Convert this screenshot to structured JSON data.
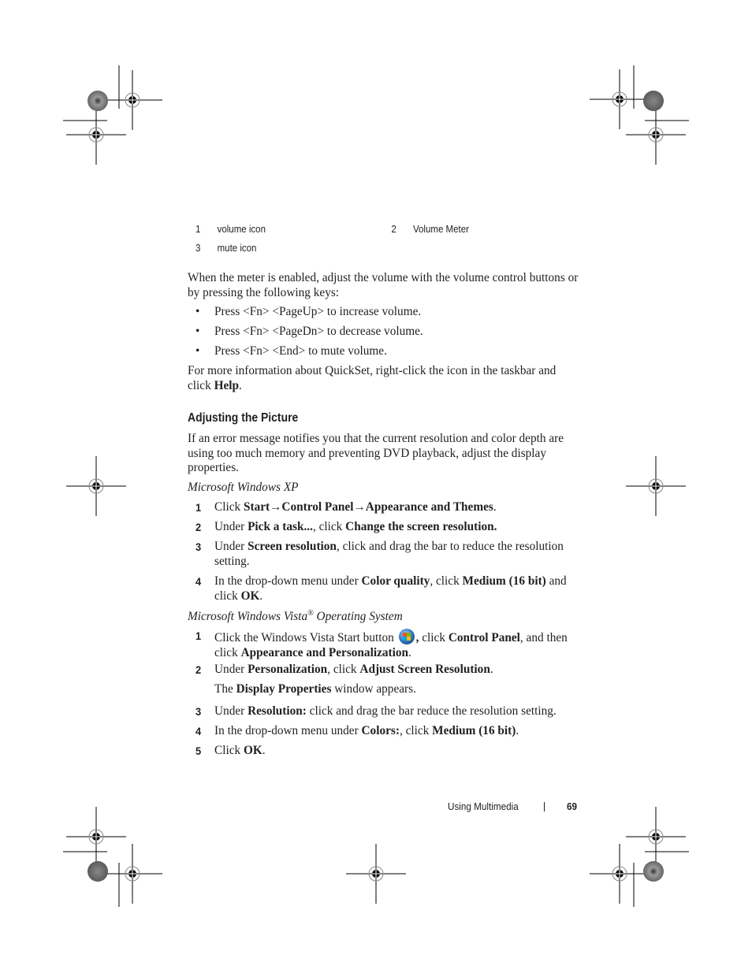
{
  "callouts": [
    {
      "number": "1",
      "label": "volume icon"
    },
    {
      "number": "2",
      "label": "Volume Meter"
    },
    {
      "number": "3",
      "label": "mute icon"
    }
  ],
  "intro_paragraph": "When the meter is enabled, adjust the volume with the volume control buttons or by pressing the following keys:",
  "bullets": [
    "Press <Fn> <PageUp> to increase volume.",
    "Press <Fn> <PageDn> to decrease volume.",
    "Press <Fn> <End> to mute volume."
  ],
  "bullet_glyph": "•",
  "quickset_paragraph": {
    "before": "For more information about QuickSet, right-click the icon in the taskbar and click ",
    "bold": "Help",
    "after": "."
  },
  "section_heading": "Adjusting the Picture",
  "section_intro": "If an error message notifies you that the current resolution and color depth are using too much memory and preventing DVD playback, adjust the display properties.",
  "xp": {
    "subheading": "Microsoft Windows XP",
    "steps": [
      {
        "num": "1",
        "parts": [
          [
            "Click ",
            false
          ],
          [
            "Start→Control Panel→Appearance and Themes",
            true
          ],
          [
            ".",
            false
          ]
        ]
      },
      {
        "num": "2",
        "parts": [
          [
            "Under ",
            false
          ],
          [
            "Pick a task...",
            true
          ],
          [
            ", click ",
            false
          ],
          [
            "Change the screen resolution.",
            true
          ]
        ]
      },
      {
        "num": "3",
        "parts": [
          [
            "Under ",
            false
          ],
          [
            "Screen resolution",
            true
          ],
          [
            ", click and drag the bar to reduce the resolution setting.",
            false
          ]
        ]
      },
      {
        "num": "4",
        "parts": [
          [
            "In the drop-down menu under ",
            false
          ],
          [
            "Color quality",
            true
          ],
          [
            ", click ",
            false
          ],
          [
            "Medium (16 bit)",
            true
          ],
          [
            " and click ",
            false
          ],
          [
            "OK",
            true
          ],
          [
            ".",
            false
          ]
        ]
      }
    ]
  },
  "vista": {
    "subheading": "Microsoft Windows Vista",
    "subheading_mark": "®",
    "subheading_suffix": " Operating System",
    "start_button_icon": "windows-vista-start-icon",
    "steps": [
      {
        "num": "1",
        "parts": [
          [
            "Click the Windows Vista Start button ",
            false
          ],
          [
            "__ICON__",
            false
          ],
          [
            ",",
            true
          ],
          [
            "  click ",
            false
          ],
          [
            "Control Panel",
            true
          ],
          [
            ", and then click ",
            false
          ],
          [
            "Appearance and Personalization",
            true
          ],
          [
            ".",
            false
          ]
        ]
      },
      {
        "num": "2",
        "parts": [
          [
            "Under ",
            false
          ],
          [
            "Personalization",
            true
          ],
          [
            ", click ",
            false
          ],
          [
            "Adjust Screen Resolution",
            true
          ],
          [
            ".",
            false
          ]
        ]
      },
      {
        "num": "",
        "parts": [
          [
            "The ",
            false
          ],
          [
            "Display Properties",
            true
          ],
          [
            " window appears.",
            false
          ]
        ]
      },
      {
        "num": "3",
        "parts": [
          [
            "Under ",
            false
          ],
          [
            "Resolution:",
            true
          ],
          [
            " click and drag the bar reduce the resolution setting.",
            false
          ]
        ]
      },
      {
        "num": "4",
        "parts": [
          [
            "In the drop-down menu under ",
            false
          ],
          [
            "Colors:",
            true
          ],
          [
            ", click ",
            false
          ],
          [
            "Medium (16 bit)",
            true
          ],
          [
            ".",
            false
          ]
        ]
      },
      {
        "num": "5",
        "parts": [
          [
            "Click ",
            false
          ],
          [
            "OK",
            true
          ],
          [
            ".",
            false
          ]
        ]
      }
    ]
  },
  "footer": {
    "section": "Using Multimedia",
    "page_number": "69"
  },
  "colors": {
    "text": "#231f20",
    "background": "#ffffff"
  }
}
